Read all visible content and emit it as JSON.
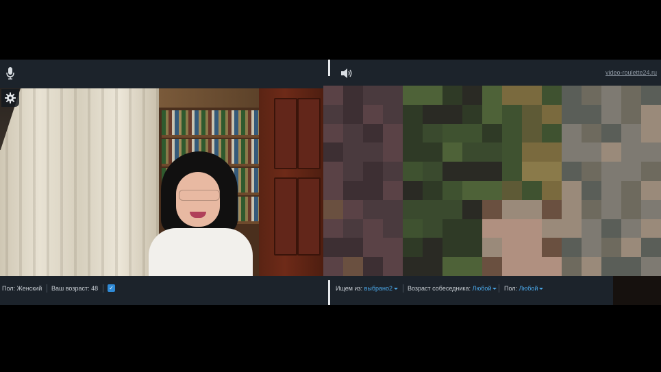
{
  "header": {
    "site_link": "video-roulette24.ru",
    "mic_icon": "microphone-icon",
    "speaker_icon": "speaker-icon",
    "gear_icon": "gear-icon"
  },
  "footer": {
    "gender_label": "Пол:",
    "gender_value": "Женский",
    "age_label": "Ваш возраст:",
    "age_value": "48",
    "checkbox_mark": "✓",
    "search_from_label": "Ищем из:",
    "search_from_value": "выбрано2",
    "partner_age_label": "Возраст собеседника:",
    "partner_age_value": "Любой",
    "partner_gender_label": "Пол:",
    "partner_gender_value": "Любой"
  },
  "colors": {
    "bar_bg": "#1c232b",
    "link_blue": "#4aa6e6",
    "divider": "#e6e9ec"
  }
}
